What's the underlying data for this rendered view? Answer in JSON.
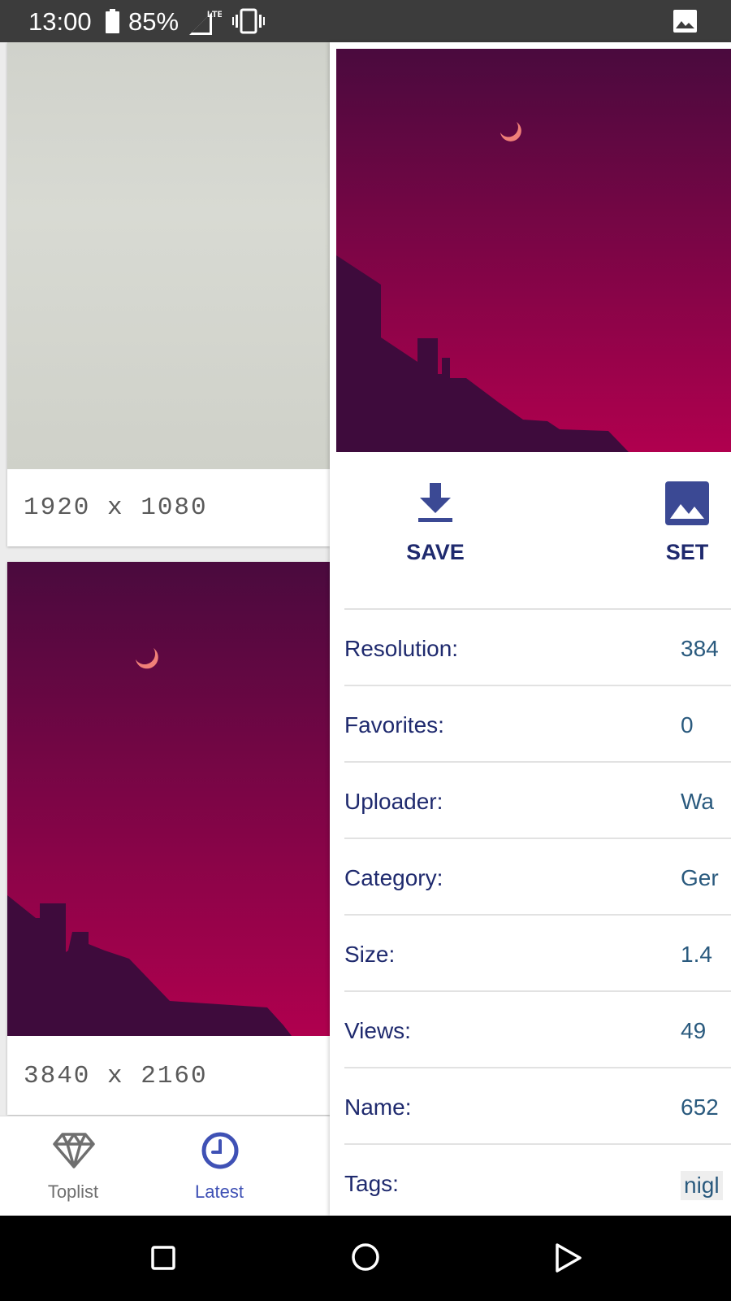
{
  "status_bar": {
    "time": "13:00",
    "battery": "85%",
    "icons": [
      "battery-icon",
      "lte-signal-icon",
      "vibrate-icon",
      "image-notification-icon"
    ]
  },
  "grid": {
    "cards": [
      {
        "resolution": "1920 x 1080"
      },
      {
        "resolution": "3840 x 2160"
      }
    ]
  },
  "bottom_nav": {
    "items": [
      {
        "label": "Toplist",
        "icon": "diamond-icon"
      },
      {
        "label": "Latest",
        "icon": "clock-icon",
        "active": true
      }
    ],
    "active_color": "#3f51b5"
  },
  "detail": {
    "actions": {
      "save_label": "SAVE",
      "set_label": "SET"
    },
    "info": [
      {
        "key": "Resolution:",
        "value": "384"
      },
      {
        "key": "Favorites:",
        "value": "0"
      },
      {
        "key": "Uploader:",
        "value": "Wa"
      },
      {
        "key": "Category:",
        "value": "Ger"
      },
      {
        "key": "Size:",
        "value": "1.4"
      },
      {
        "key": "Views:",
        "value": "49"
      },
      {
        "key": "Name:",
        "value": "652"
      },
      {
        "key": "Tags:",
        "value": "nigl"
      }
    ]
  },
  "system_nav": {
    "icons": [
      "recents-icon",
      "home-icon",
      "back-icon"
    ]
  },
  "colors": {
    "accent": "#3f51b5",
    "label_text": "#1f2a6e",
    "value_text": "#2a5a7e",
    "wallpaper_top": "#4a0a3e",
    "wallpaper_bottom": "#b0004e"
  }
}
